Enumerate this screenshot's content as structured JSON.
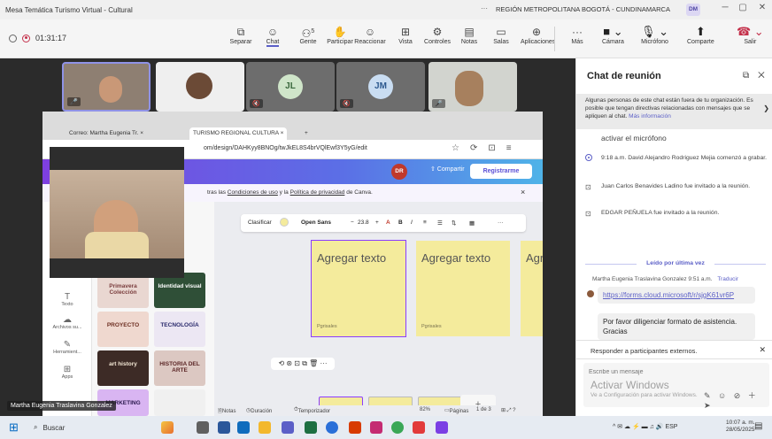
{
  "window": {
    "title": "Mesa Temática Turismo Virtual - Cultural",
    "org": "REGIÓN METROPOLITANA BOGOTÁ - CUNDINAMARCA",
    "org_avatar": "DM",
    "more": "···"
  },
  "meeting": {
    "timer": "01:31:17",
    "tools": [
      {
        "icon": "⧉",
        "label": "Separar",
        "name": "separar"
      },
      {
        "icon": "☺",
        "label": "Chat",
        "name": "chat"
      },
      {
        "icon": "⚇",
        "label": "Gente",
        "name": "gente",
        "badge": "5"
      },
      {
        "icon": "✋",
        "label": "Participar",
        "name": "participar"
      },
      {
        "icon": "☺",
        "label": "Reaccionar",
        "name": "reaccionar"
      },
      {
        "icon": "⊞",
        "label": "Vista",
        "name": "vista"
      },
      {
        "icon": "⚙",
        "label": "Controles",
        "name": "controles"
      },
      {
        "icon": "▤",
        "label": "Notas",
        "name": "notas"
      },
      {
        "icon": "▭",
        "label": "Salas",
        "name": "salas"
      },
      {
        "icon": "⊕",
        "label": "Aplicaciones",
        "name": "aplicaciones"
      },
      {
        "icon": "···",
        "label": "Más",
        "name": "mas"
      }
    ],
    "camera": "Cámara",
    "mic": "Micrófono",
    "share": "Comparte",
    "leave": "Salir",
    "participants": [
      {
        "initials": "JL",
        "bg": "#cfe5c9",
        "fg": "#38663b"
      },
      {
        "initials": "JM",
        "bg": "#c9ddf2",
        "fg": "#2e5a8f"
      }
    ],
    "speaker_name": "Martha Eugenia Traslavina Gonzalez"
  },
  "browser": {
    "tabs": [
      {
        "label": "Correo: Martha Eugenia Tr. ×"
      },
      {
        "label": "TURISMO REGIONAL CULTURA ×"
      },
      {
        "label": "+"
      }
    ],
    "url": "om/design/DAHKyy8BNOg/twJkEL8S4brVQlEwf3Y5yG/edit",
    "share": "⇧ Compartir",
    "register": "Registrarme",
    "user": "DR",
    "notice_pre": "tras las ",
    "notice_link1": "Condiciones de uso",
    "notice_mid": " y la ",
    "notice_link2": "Política de privacidad",
    "notice_post": " de Canva.",
    "notice_close": "×"
  },
  "canva": {
    "toolbar": {
      "classify": "Clasificar",
      "font": "Open Sans",
      "size": "23.8",
      "minus": "−",
      "plus": "+"
    },
    "sticky_text": "Agregar texto",
    "sticky_text_cut": "Agregar te",
    "sticky_footer": "Pgrisales",
    "sidebar": [
      {
        "label": "Texto",
        "icon": "T"
      },
      {
        "label": "Archivos su...",
        "icon": "☁"
      },
      {
        "label": "Herramient...",
        "icon": "✎"
      },
      {
        "label": "Apps",
        "icon": "⊞"
      }
    ],
    "thumbs": [
      {
        "title": "Primavera Colección",
        "bg": "#e9d7d1",
        "fg": "#7a3d3d"
      },
      {
        "title": "Identidad visual",
        "bg": "#2f4f37",
        "fg": "#fff"
      },
      {
        "title": "PROYECTO",
        "bg": "#efd8cf",
        "fg": "#6d2f22"
      },
      {
        "title": "TECNOLOGÍA",
        "bg": "#ece7f3",
        "fg": "#2a2a6c"
      },
      {
        "title": "art history",
        "bg": "#3d2b26",
        "fg": "#f5e9d6"
      },
      {
        "title": "HISTORIA DEL ARTE",
        "bg": "#dcc8c2",
        "fg": "#5b2626"
      },
      {
        "title": "MARKETING",
        "bg": "#d9b5f2",
        "fg": "#2a184d"
      },
      {
        "title": "",
        "bg": "#f0f0f0",
        "fg": "#333"
      }
    ],
    "status": {
      "notes": "Notas",
      "duration": "Duración",
      "timer": "Temporizador",
      "zoom": "82%",
      "pages": "Páginas",
      "page_count": "1 de 3"
    },
    "page_add": "+"
  },
  "chat": {
    "title": "Chat de reunión",
    "warning": "Algunas personas de este chat están fuera de tu organización. Es posible que tengan directivas relacionadas con mensajes que se apliquen al chat.",
    "warning_link": "Más información",
    "events": [
      {
        "text": "activar el micrófono",
        "icon": ""
      },
      {
        "text": "9:18 a.m.   David Alejandro Rodriguez Mejia comenzó a grabar.",
        "icon": "radio"
      },
      {
        "text": "Juan Carlos Benavides Ladino fue invitado a la reunión.",
        "icon": "invite"
      },
      {
        "text": "EDGAR PEÑUELA fue invitado a la reunión.",
        "icon": "invite"
      }
    ],
    "read_marker": "Leído por última vez",
    "message": {
      "author": "Martha Eugenia Traslavina Gonzalez",
      "time": "9:51 a.m.",
      "translate": "Traducir",
      "link": "https://forms.cloud.microsoft/r/sjgK61vr6P",
      "text": "Por favor diligenciar formato de asistencia. Gracias"
    },
    "reply_label": "Responder a participantes externos.",
    "compose_placeholder": "Escribe un mensaje",
    "watermark_title": "Activar Windows",
    "watermark_sub": "Ve a Configuración para activar Windows."
  },
  "taskbar": {
    "search": "Buscar",
    "lang": "ESP",
    "time": "10:07 a. m.",
    "date": "28/05/2025"
  }
}
